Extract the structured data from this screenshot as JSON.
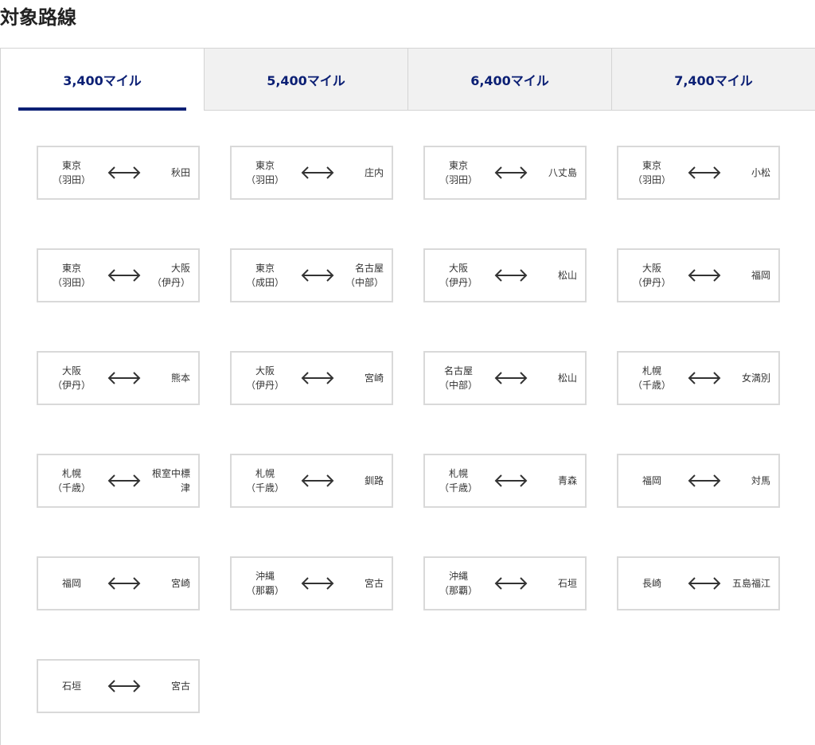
{
  "page": {
    "title": "対象路線"
  },
  "tabs": [
    {
      "label": "3,400マイル",
      "active": true
    },
    {
      "label": "5,400マイル",
      "active": false
    },
    {
      "label": "6,400マイル",
      "active": false
    },
    {
      "label": "7,400マイル",
      "active": false
    }
  ],
  "routes": [
    {
      "from": [
        "東京",
        "（羽田）"
      ],
      "to": [
        "秋田"
      ]
    },
    {
      "from": [
        "東京",
        "（羽田）"
      ],
      "to": [
        "庄内"
      ]
    },
    {
      "from": [
        "東京",
        "（羽田）"
      ],
      "to": [
        "八丈島"
      ]
    },
    {
      "from": [
        "東京",
        "（羽田）"
      ],
      "to": [
        "小松"
      ]
    },
    {
      "from": [
        "東京",
        "（羽田）"
      ],
      "to": [
        "大阪",
        "（伊丹）"
      ]
    },
    {
      "from": [
        "東京",
        "（成田）"
      ],
      "to": [
        "名古屋",
        "（中部）"
      ]
    },
    {
      "from": [
        "大阪",
        "（伊丹）"
      ],
      "to": [
        "松山"
      ]
    },
    {
      "from": [
        "大阪",
        "（伊丹）"
      ],
      "to": [
        "福岡"
      ]
    },
    {
      "from": [
        "大阪",
        "（伊丹）"
      ],
      "to": [
        "熊本"
      ]
    },
    {
      "from": [
        "大阪",
        "（伊丹）"
      ],
      "to": [
        "宮崎"
      ]
    },
    {
      "from": [
        "名古屋",
        "（中部）"
      ],
      "to": [
        "松山"
      ]
    },
    {
      "from": [
        "札幌",
        "（千歳）"
      ],
      "to": [
        "女満別"
      ]
    },
    {
      "from": [
        "札幌",
        "（千歳）"
      ],
      "to": [
        "根室中標",
        "津"
      ]
    },
    {
      "from": [
        "札幌",
        "（千歳）"
      ],
      "to": [
        "釧路"
      ]
    },
    {
      "from": [
        "札幌",
        "（千歳）"
      ],
      "to": [
        "青森"
      ]
    },
    {
      "from": [
        "福岡"
      ],
      "to": [
        "対馬"
      ]
    },
    {
      "from": [
        "福岡"
      ],
      "to": [
        "宮崎"
      ]
    },
    {
      "from": [
        "沖縄",
        "（那覇）"
      ],
      "to": [
        "宮古"
      ]
    },
    {
      "from": [
        "沖縄",
        "（那覇）"
      ],
      "to": [
        "石垣"
      ]
    },
    {
      "from": [
        "長崎"
      ],
      "to": [
        "五島福江"
      ]
    },
    {
      "from": [
        "石垣"
      ],
      "to": [
        "宮古"
      ]
    }
  ],
  "icons": {
    "route_arrow": "double-arrow-icon"
  },
  "colors": {
    "accent": "#0b1f74",
    "tab_inactive_bg": "#f1f1f1",
    "border": "#d9d9d9"
  }
}
